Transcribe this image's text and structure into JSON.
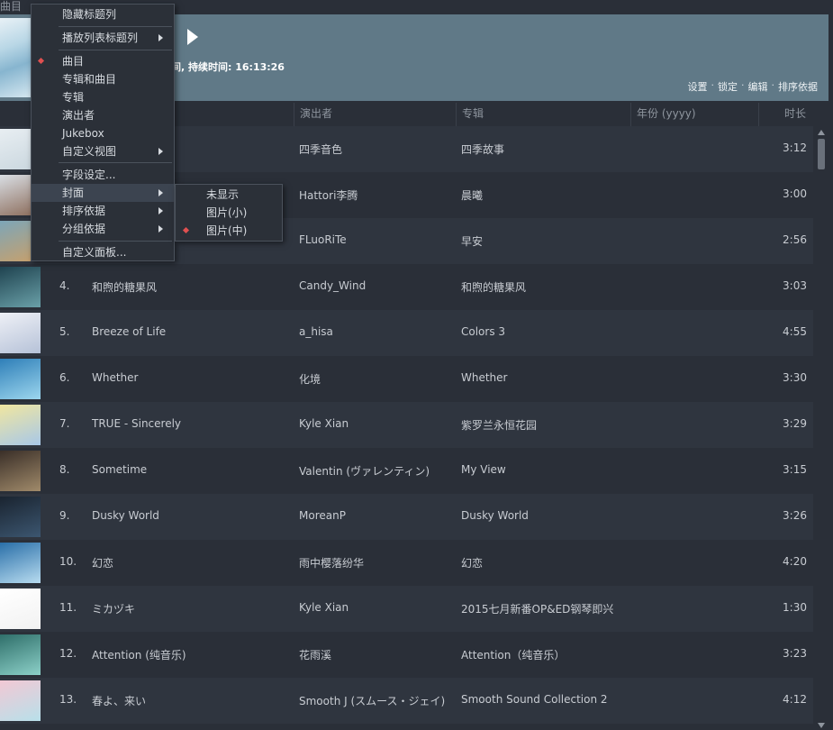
{
  "window": {
    "title_fragment": "曲目"
  },
  "banner": {
    "info_text": "间, 持续时间: 16:13:26",
    "actions": [
      "设置",
      "锁定",
      "编辑",
      "排序依据"
    ]
  },
  "columns": [
    "演出者",
    "专辑",
    "年份 (yyyy)",
    "时长"
  ],
  "rows": [
    {
      "num": "",
      "title": "",
      "artist": "四季音色",
      "album": "四季故事",
      "duration": "3:12"
    },
    {
      "num": "",
      "title": "",
      "artist": "Hattori李腾",
      "album": "晨曦",
      "duration": "3:00"
    },
    {
      "num": "",
      "title": "",
      "artist": "FLuoRiTe",
      "album": "早安",
      "duration": "2:56"
    },
    {
      "num": "4.",
      "title": "和煦的糖果风",
      "artist": "Candy_Wind",
      "album": "和煦的糖果风",
      "duration": "3:03"
    },
    {
      "num": "5.",
      "title": "Breeze of Life",
      "artist": "a_hisa",
      "album": "Colors 3",
      "duration": "4:55"
    },
    {
      "num": "6.",
      "title": "Whether",
      "artist": "化境",
      "album": "Whether",
      "duration": "3:30"
    },
    {
      "num": "7.",
      "title": "TRUE - Sincerely",
      "artist": "Kyle Xian",
      "album": "紫罗兰永恒花园",
      "duration": "3:29"
    },
    {
      "num": "8.",
      "title": "Sometime",
      "artist": "Valentin (ヴァレンティン)",
      "album": "My View",
      "duration": "3:15"
    },
    {
      "num": "9.",
      "title": "Dusky World",
      "artist": "MoreanP",
      "album": "Dusky World",
      "duration": "3:26"
    },
    {
      "num": "10.",
      "title": "幻恋",
      "artist": "雨中樱落纷华",
      "album": "幻恋",
      "duration": "4:20"
    },
    {
      "num": "11.",
      "title": "ミカヅキ",
      "artist": "Kyle Xian",
      "album": "2015七月新番OP&ED钢琴即兴",
      "duration": "1:30"
    },
    {
      "num": "12.",
      "title": "Attention (纯音乐)",
      "artist": "花雨溪",
      "album": "Attention（纯音乐）",
      "duration": "3:23"
    },
    {
      "num": "13.",
      "title": "春よ、来い",
      "artist": "Smooth J (スムース・ジェイ)",
      "album": "Smooth Sound Collection 2",
      "duration": "4:12"
    }
  ],
  "thumb_colors": [
    [
      "#e8eef2",
      "#c9d6de"
    ],
    [
      "#d9dee4",
      "#8a6a58"
    ],
    [
      "#7da6b8",
      "#c9a06a"
    ],
    [
      "#1f4350",
      "#6aa0a8"
    ],
    [
      "#eef0f6",
      "#b6c2d8"
    ],
    [
      "#2f7fb8",
      "#9cd6ee"
    ],
    [
      "#f0e6a0",
      "#a8c8e8"
    ],
    [
      "#3a2f28",
      "#a08a6a"
    ],
    [
      "#1a2430",
      "#3c5670"
    ],
    [
      "#2a6fa8",
      "#b8dcf0"
    ],
    [
      "#ffffff",
      "#f2f2f2"
    ],
    [
      "#2f6f6a",
      "#8cd0c8"
    ],
    [
      "#f2c8d4",
      "#b8e0ea"
    ]
  ],
  "menu": {
    "items": [
      {
        "label": "隐藏标题列",
        "submenu": false,
        "checked": false
      },
      {
        "label": "播放列表标题列",
        "submenu": true,
        "checked": false
      },
      {
        "label": "曲目",
        "submenu": false,
        "checked": true
      },
      {
        "label": "专辑和曲目",
        "submenu": false,
        "checked": false
      },
      {
        "label": "专辑",
        "submenu": false,
        "checked": false
      },
      {
        "label": "演出者",
        "submenu": false,
        "checked": false
      },
      {
        "label": "Jukebox",
        "submenu": false,
        "checked": false
      },
      {
        "label": "自定义视图",
        "submenu": true,
        "checked": false
      },
      {
        "label": "字段设定...",
        "submenu": false,
        "checked": false
      },
      {
        "label": "封面",
        "submenu": true,
        "checked": false,
        "active": true
      },
      {
        "label": "排序依据",
        "submenu": true,
        "checked": false
      },
      {
        "label": "分组依据",
        "submenu": true,
        "checked": false
      },
      {
        "label": "自定义面板...",
        "submenu": false,
        "checked": false
      }
    ],
    "submenu_items": [
      {
        "label": "未显示",
        "checked": false
      },
      {
        "label": "图片(小)",
        "checked": false
      },
      {
        "label": "图片(中)",
        "checked": true
      }
    ]
  }
}
